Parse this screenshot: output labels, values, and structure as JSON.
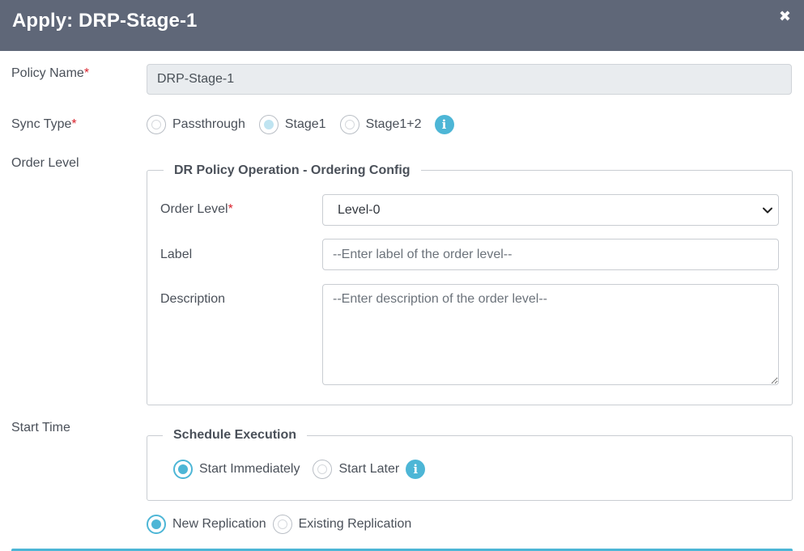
{
  "header": {
    "title": "Apply: DRP-Stage-1",
    "close_glyph": "✖"
  },
  "form": {
    "policy_name": {
      "label": "Policy Name",
      "required_mark": "*",
      "value": "DRP-Stage-1"
    },
    "sync_type": {
      "label": "Sync Type",
      "required_mark": "*",
      "options": [
        "Passthrough",
        "Stage1",
        "Stage1+2"
      ],
      "selected": "Stage1"
    },
    "order_level_row_label": "Order Level",
    "ordering_config": {
      "legend": "DR Policy Operation - Ordering Config",
      "order_level": {
        "label": "Order Level",
        "required_mark": "*",
        "selected": "Level-0"
      },
      "label_field": {
        "label": "Label",
        "placeholder": "--Enter label of the order level--"
      },
      "description_field": {
        "label": "Description",
        "placeholder": "--Enter description of the order level--"
      }
    },
    "start_time_row_label": "Start Time",
    "schedule": {
      "legend": "Schedule Execution",
      "options": [
        "Start Immediately",
        "Start Later"
      ],
      "selected": "Start Immediately"
    },
    "replication": {
      "options": [
        "New Replication",
        "Existing Replication"
      ],
      "selected": "New Replication"
    }
  },
  "colors": {
    "header_bg": "#5f6778",
    "accent": "#4db6d6",
    "required": "#d9232d"
  },
  "icons": {
    "info": "info-icon",
    "close": "close-icon",
    "chevron": "chevron-down-icon"
  }
}
